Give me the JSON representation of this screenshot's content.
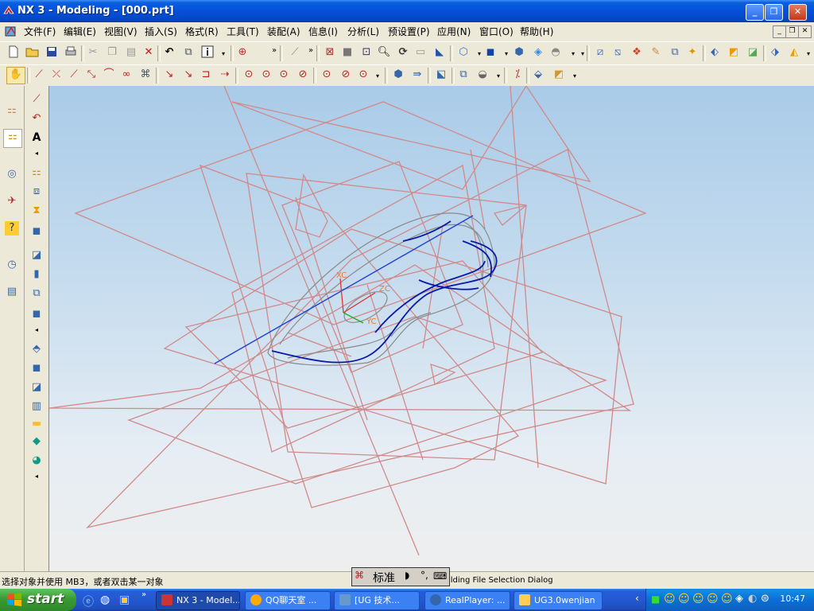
{
  "window": {
    "title": "NX 3 - Modeling - [000.prt]",
    "min_label": "_",
    "max_label": "❐",
    "close_label": "✕"
  },
  "menu": {
    "items": [
      "文件(F)",
      "编辑(E)",
      "视图(V)",
      "插入(S)",
      "格式(R)",
      "工具(T)",
      "装配(A)",
      "信息(I)",
      "分析(L)",
      "预设置(P)",
      "应用(N)",
      "窗口(O)",
      "帮助(H)"
    ]
  },
  "viewport": {
    "axis_labels": [
      "XC",
      "ZC",
      "YC"
    ]
  },
  "status": {
    "prompt": "选择对象并使用 MB3，或者双击某一对象",
    "right_text": "ilding File Selection Dialog"
  },
  "ime": {
    "mode": "标准"
  },
  "taskbar": {
    "start_label": "start",
    "tasks": [
      "NX 3 - Model...",
      "QQ聊天室 ...",
      "[UG 技术...",
      "RealPlayer: ...",
      "UG3.0wenjian"
    ],
    "clock": "10:47"
  },
  "colors": {
    "sketch_lines": "#d08a8a",
    "curves_blue": "#0a1aa8",
    "accent_title": "#0550d8"
  }
}
